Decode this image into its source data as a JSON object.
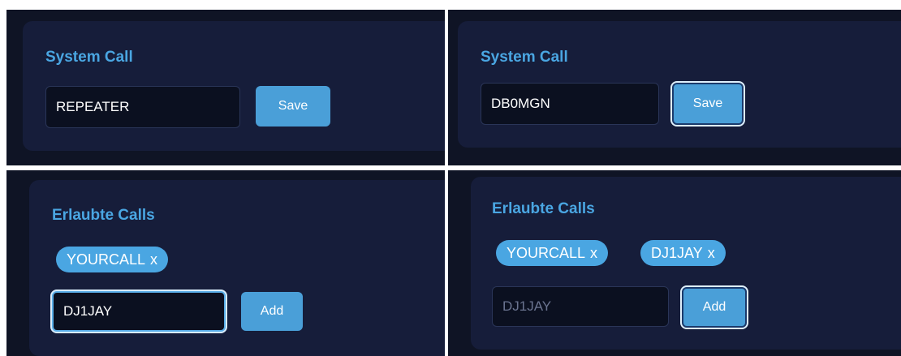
{
  "system_call_panels": [
    {
      "title": "System Call",
      "input_value": "REPEATER",
      "button_label": "Save"
    },
    {
      "title": "System Call",
      "input_value": "DB0MGN",
      "button_label": "Save"
    }
  ],
  "allowed_calls_panels": [
    {
      "title": "Erlaubte Calls",
      "chips": [
        {
          "label": "YOURCALL",
          "remove": "x"
        }
      ],
      "input_value": "DJ1JAY",
      "input_placeholder": "",
      "button_label": "Add"
    },
    {
      "title": "Erlaubte Calls",
      "chips": [
        {
          "label": "YOURCALL",
          "remove": "x"
        },
        {
          "label": "DJ1JAY",
          "remove": "x"
        }
      ],
      "input_value": "",
      "input_placeholder": "DJ1JAY",
      "button_label": "Add"
    }
  ],
  "colors": {
    "background": "#0f1425",
    "card": "#161d3a",
    "accent": "#4aa6e2",
    "button": "#4a9fd8"
  }
}
